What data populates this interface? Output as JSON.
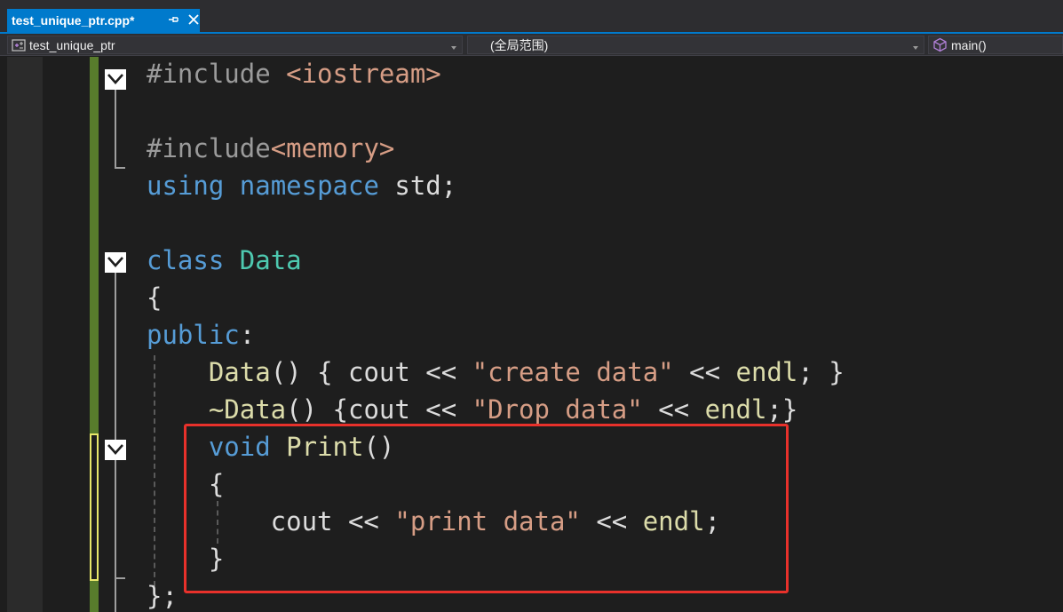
{
  "tab": {
    "title": "test_unique_ptr.cpp*",
    "pin_icon": "pin-icon",
    "close_icon": "close-icon"
  },
  "navbar": {
    "project": "test_unique_ptr",
    "scope": "(全局范围)",
    "member": "main()"
  },
  "code": {
    "lines": [
      [
        {
          "t": "#include ",
          "c": "pp"
        },
        {
          "t": "<iostream>",
          "c": "str"
        }
      ],
      [],
      [
        {
          "t": "#include",
          "c": "pp"
        },
        {
          "t": "<memory>",
          "c": "str"
        }
      ],
      [
        {
          "t": "using",
          "c": "kw"
        },
        {
          "t": " ",
          "c": "plain"
        },
        {
          "t": "namespace",
          "c": "kw"
        },
        {
          "t": " std;",
          "c": "plain"
        }
      ],
      [],
      [
        {
          "t": "class",
          "c": "kw"
        },
        {
          "t": " ",
          "c": "plain"
        },
        {
          "t": "Data",
          "c": "type"
        }
      ],
      [
        {
          "t": "{",
          "c": "plain"
        }
      ],
      [
        {
          "t": "public",
          "c": "kw"
        },
        {
          "t": ":",
          "c": "plain"
        }
      ],
      [
        {
          "t": "    ",
          "c": "plain"
        },
        {
          "t": "Data",
          "c": "fn"
        },
        {
          "t": "() { cout << ",
          "c": "plain"
        },
        {
          "t": "\"create data\"",
          "c": "str"
        },
        {
          "t": " << ",
          "c": "plain"
        },
        {
          "t": "endl",
          "c": "fn"
        },
        {
          "t": "; }",
          "c": "plain"
        }
      ],
      [
        {
          "t": "    ",
          "c": "plain"
        },
        {
          "t": "~Data",
          "c": "fn"
        },
        {
          "t": "() {cout << ",
          "c": "plain"
        },
        {
          "t": "\"Drop data\"",
          "c": "str"
        },
        {
          "t": " << ",
          "c": "plain"
        },
        {
          "t": "endl",
          "c": "fn"
        },
        {
          "t": ";}",
          "c": "plain"
        }
      ],
      [
        {
          "t": "    ",
          "c": "plain"
        },
        {
          "t": "void",
          "c": "kw"
        },
        {
          "t": " ",
          "c": "plain"
        },
        {
          "t": "Print",
          "c": "fn"
        },
        {
          "t": "()",
          "c": "plain"
        }
      ],
      [
        {
          "t": "    {",
          "c": "plain"
        }
      ],
      [
        {
          "t": "        cout << ",
          "c": "plain"
        },
        {
          "t": "\"print data\"",
          "c": "str"
        },
        {
          "t": " << ",
          "c": "plain"
        },
        {
          "t": "endl",
          "c": "fn"
        },
        {
          "t": ";",
          "c": "plain"
        }
      ],
      [
        {
          "t": "    }",
          "c": "plain"
        }
      ],
      [
        {
          "t": "};",
          "c": "plain"
        }
      ]
    ]
  },
  "colors": {
    "accent": "#007acc",
    "keyword": "#569cd6",
    "string": "#d69d85",
    "type": "#4ec9b0",
    "function": "#dcdcaa",
    "preprocessor": "#9b9b9b",
    "text": "#dcdcdc",
    "saved_change": "#587c2c",
    "unsaved_change": "#e8e86a",
    "highlight": "#e8312b"
  }
}
